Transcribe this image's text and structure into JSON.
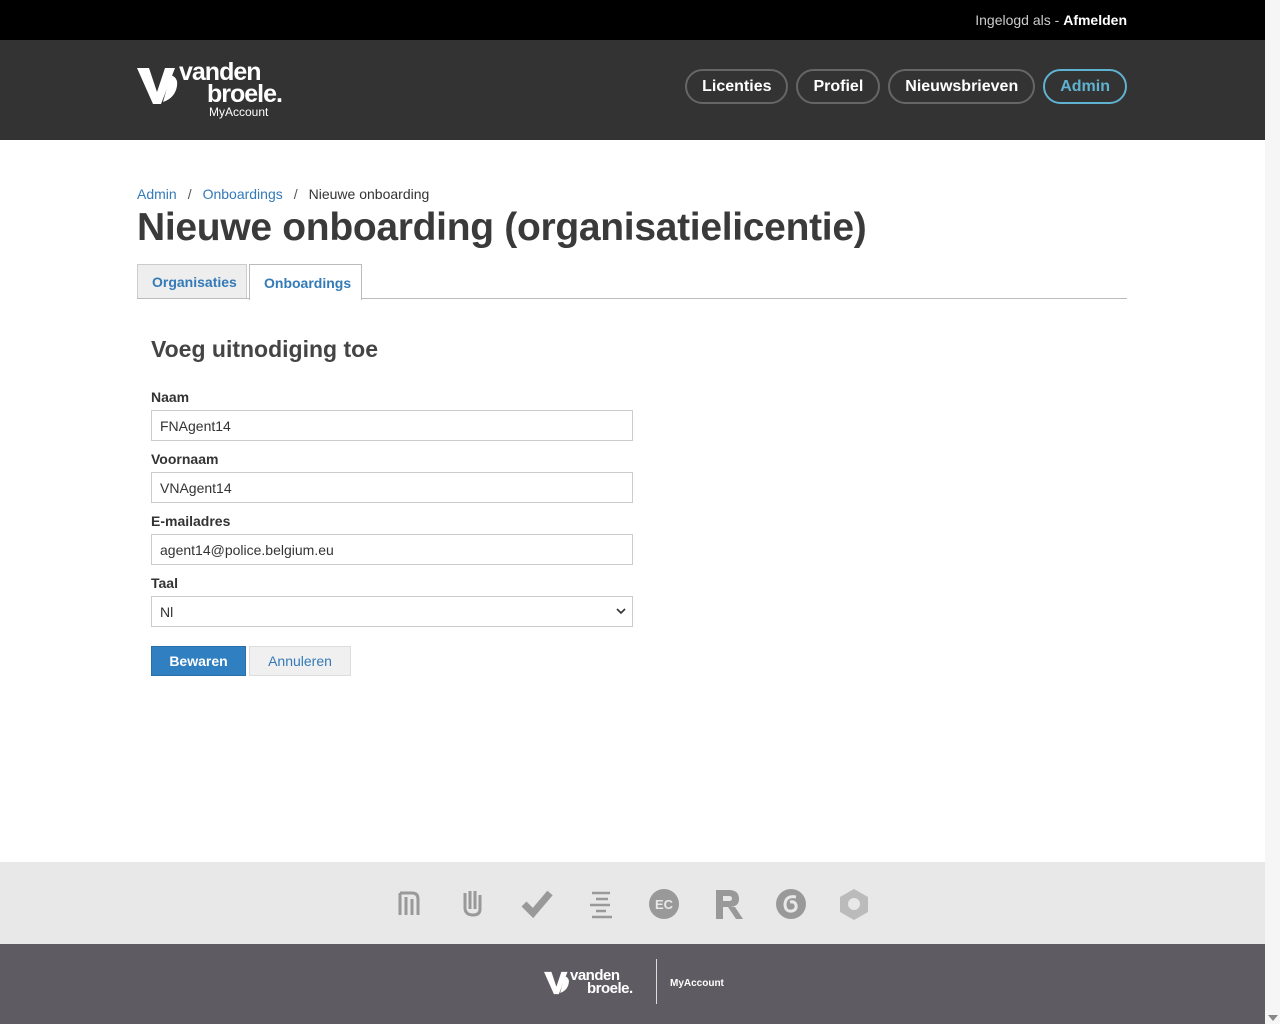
{
  "topbar": {
    "logged_in_text": "Ingelogd als -",
    "logout_label": "Afmelden"
  },
  "logo": {
    "word1": "vanden",
    "word2": "broele.",
    "sub": "MyAccount"
  },
  "nav": {
    "items": [
      "Licenties",
      "Profiel",
      "Nieuwsbrieven",
      "Admin"
    ],
    "active": "Admin"
  },
  "breadcrumb": {
    "items": [
      "Admin",
      "Onboardings"
    ],
    "current": "Nieuwe onboarding",
    "separator": "/"
  },
  "page_title": "Nieuwe onboarding (organisatielicentie)",
  "tabs": [
    {
      "label": "Organisaties"
    },
    {
      "label": "Onboardings",
      "active": true
    }
  ],
  "form": {
    "heading": "Voeg uitnodiging toe",
    "naam": {
      "label": "Naam",
      "value": "FNAgent14"
    },
    "voornaam": {
      "label": "Voornaam",
      "value": "VNAgent14"
    },
    "email": {
      "label": "E-mailadres",
      "value": "agent14@police.belgium.eu"
    },
    "taal": {
      "label": "Taal",
      "value": "Nl"
    },
    "save_label": "Bewaren",
    "cancel_label": "Annuleren"
  },
  "brands": [
    "pelckmans-icon",
    "hand-icon",
    "checkmark-icon",
    "lines-icon",
    "ec-icon",
    "r-icon",
    "spiral-icon",
    "hexagon-icon"
  ],
  "footer": {
    "word1": "vanden",
    "word2": "broele.",
    "product": "MyAccount"
  },
  "colors": {
    "accent": "#2f7fc1",
    "link": "#337ab7",
    "header_bg": "#333333",
    "footer_bg": "#5e5b62",
    "active_nav": "#5fb3d1"
  }
}
